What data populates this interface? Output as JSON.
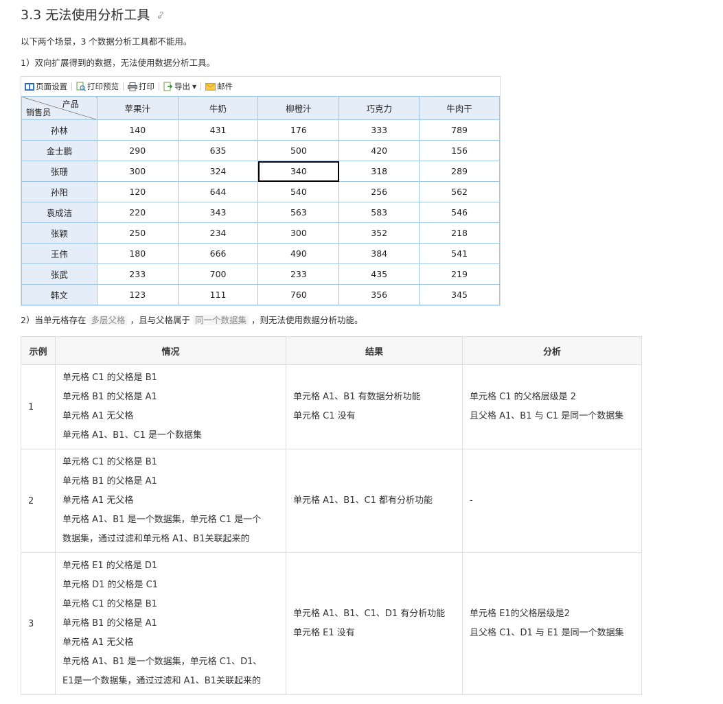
{
  "heading": {
    "title": "3.3 无法使用分析工具"
  },
  "intro": "以下两个场景，3 个数据分析工具都不能用。",
  "scenario1": "1）双向扩展得到的数据，无法使用数据分析工具。",
  "toolbar": {
    "page_setup": "页面设置",
    "print_preview": "打印预览",
    "print": "打印",
    "export": "导出",
    "mail": "邮件"
  },
  "report": {
    "corner_top": "产品",
    "corner_bottom": "销售员",
    "columns": [
      "苹果汁",
      "牛奶",
      "柳橙汁",
      "巧克力",
      "牛肉干"
    ],
    "rows": [
      {
        "name": "孙林",
        "values": [
          "140",
          "431",
          "176",
          "333",
          "789"
        ]
      },
      {
        "name": "金士鹏",
        "values": [
          "290",
          "635",
          "500",
          "420",
          "156"
        ]
      },
      {
        "name": "张珊",
        "values": [
          "300",
          "324",
          "340",
          "318",
          "289"
        ]
      },
      {
        "name": "孙阳",
        "values": [
          "120",
          "644",
          "540",
          "256",
          "562"
        ]
      },
      {
        "name": "袁成洁",
        "values": [
          "220",
          "343",
          "563",
          "583",
          "546"
        ]
      },
      {
        "name": "张颖",
        "values": [
          "250",
          "234",
          "300",
          "352",
          "218"
        ]
      },
      {
        "name": "王伟",
        "values": [
          "180",
          "666",
          "490",
          "384",
          "541"
        ]
      },
      {
        "name": "张武",
        "values": [
          "233",
          "700",
          "233",
          "435",
          "219"
        ]
      },
      {
        "name": "韩文",
        "values": [
          "123",
          "111",
          "760",
          "356",
          "345"
        ]
      }
    ]
  },
  "scenario2": {
    "p1": "2）当单元格存在",
    "hl1": "多层父格",
    "p2": "，且与父格属于",
    "hl2": "同一个数据集",
    "p3": "，则无法使用数据分析功能。"
  },
  "table": {
    "headers": [
      "示例",
      "情况",
      "结果",
      "分析"
    ],
    "rows": [
      {
        "num": "1",
        "situation": [
          "单元格 C1 的父格是 B1",
          "单元格 B1 的父格是 A1",
          "单元格 A1 无父格",
          "单元格 A1、B1、C1 是一个数据集"
        ],
        "result": [
          "单元格 A1、B1 有数据分析功能",
          "单元格 C1 没有"
        ],
        "analysis": [
          "单元格 C1 的父格层级是 2",
          "且父格 A1、B1 与 C1 是同一个数据集"
        ]
      },
      {
        "num": "2",
        "situation": [
          "单元格 C1 的父格是 B1",
          "单元格 B1 的父格是 A1",
          "单元格 A1 无父格",
          "单元格 A1、B1 是一个数据集，单元格 C1 是一个",
          "数据集，通过过滤和单元格 A1、B1关联起来的"
        ],
        "result": [
          "单元格 A1、B1、C1 都有分析功能"
        ],
        "analysis": [
          "-"
        ]
      },
      {
        "num": "3",
        "situation": [
          "单元格 E1 的父格是 D1",
          "单元格 D1 的父格是 C1",
          "单元格 C1 的父格是 B1",
          "单元格 B1 的父格是 A1",
          "单元格 A1 无父格",
          "单元格 A1、B1 是一个数据集，单元格 C1、D1、",
          "E1是一个数据集，通过过滤和 A1、B1关联起来的"
        ],
        "result": [
          "单元格 A1、B1、C1、D1 有分析功能",
          "单元格 E1 没有"
        ],
        "analysis": [
          "单元格 E1的父格层级是2",
          "且父格 C1、D1 与 E1 是同一个数据集"
        ]
      }
    ]
  }
}
